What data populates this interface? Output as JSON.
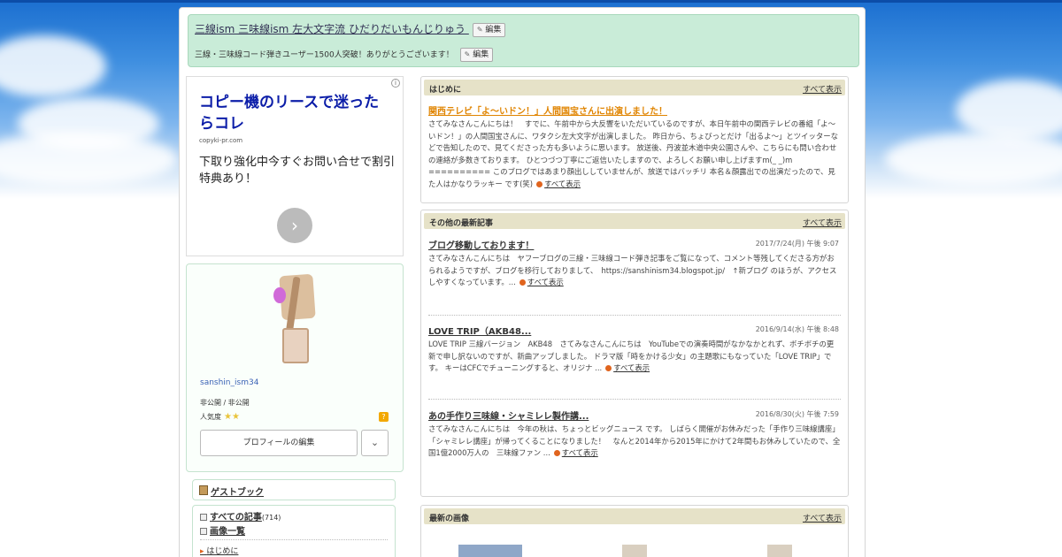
{
  "colors": {
    "sky_top": "#1b6fd0",
    "header_bg": "#c9ecd8",
    "panel_head": "#e6e2c8",
    "featured_link": "#e08400",
    "ad_headline": "#0b1da8"
  },
  "blog": {
    "title": "三線ism 三味線ism 左大文字流 ひだりだいもんじりゅう",
    "description": "三線・三味線コード弾きユーザー1500人突破！ありがとうございます！",
    "edit_label": "編集"
  },
  "ad": {
    "headline": "コピー機のリースで迷ったらコレ",
    "url": "copyki-pr.com",
    "body": "下取り強化中今すぐお問い合せで割引特典あり！",
    "info_icon": "info-icon",
    "go_icon": "chevron-right-icon"
  },
  "profile": {
    "username": "sanshin_ism34",
    "follow": "非公開 / 非公開",
    "popularity_label": "人気度",
    "stars": "★★",
    "help": "?",
    "edit_button": "プロフィールの編集",
    "dropdown": "⌄"
  },
  "sidebar": {
    "guestbook": "ゲストブック",
    "all_articles": "すべての記事",
    "article_count": "(714)",
    "image_list": "画像一覧",
    "category": "はじめに"
  },
  "main": {
    "intro": {
      "header": "はじめに",
      "all": "すべて表示",
      "post_title": "関西テレビ「よ〜いドン！」人間国宝さんに出演しました！",
      "post_body": "さてみなさんこんにちは！　すでに、午前中から大反響をいただいているのですが、本日午前中の関西テレビの番組「よ〜いドン！」の人間国宝さんに、ワタクシ左大文字が出演しました。 昨日から、ちょびっとだけ「出るよ〜」とツイッターなどで告知したので、見てくださった方も多いように思います。 放送後、丹波並木道中央公園さんや、こちらにも問い合わせの連絡が多数きております。 ひとつづつ丁寧にご返信いたしますので、よろしくお願い申し上げますm(_ _)m ========== このブログではあまり顔出ししていませんが、放送ではバッチリ 本名＆顔露出での出演だったので、見た人はかなりラッキー です(笑)",
      "more": "すべて表示"
    },
    "latest": {
      "header": "その他の最新記事",
      "all": "すべて表示",
      "posts": [
        {
          "title": "ブログ移動しております！",
          "date": "2017/7/24(月) 午後 9:07",
          "body": "さてみなさんこんにちは　ヤフーブログの三線・三味線コード弾き記事をご覧になって、コメント等残してくださる方がおられるようですが、ブログを移行しておりまして、　https://sanshinism34.blogspot.jp/　↑新ブログ のほうが、アクセスしやすくなっています。...",
          "more": "すべて表示"
        },
        {
          "title": "LOVE TRIP（AKB48...",
          "date": "2016/9/14(水) 午後 8:48",
          "body": "LOVE TRIP 三線バージョン　AKB48　さてみなさんこんにちは　YouTubeでの演奏時間がなかなかとれず、ボチボチの更新で申し訳ないのですが、新曲アップしました。 ドラマ版「時をかける少女」の主題歌にもなっていた「LOVE TRIP」です。 キーはCFCでチューニングすると、オリジナ ...",
          "more": "すべて表示"
        },
        {
          "title": "あの手作り三味線・シャミレレ製作講...",
          "date": "2016/8/30(火) 午後 7:59",
          "body": "さてみなさんこんにちは　今年の秋は、ちょっとビッグニュース です。 しばらく開催がお休みだった「手作り三味線講座」「シャミレレ講座」が帰ってくることになりました！　なんと2014年から2015年にかけて2年間もお休みしていたので、全国1億2000万人の　三味線ファン ...",
          "more": "すべて表示"
        }
      ]
    },
    "images": {
      "header": "最新の画像",
      "all": "すべて表示"
    }
  }
}
